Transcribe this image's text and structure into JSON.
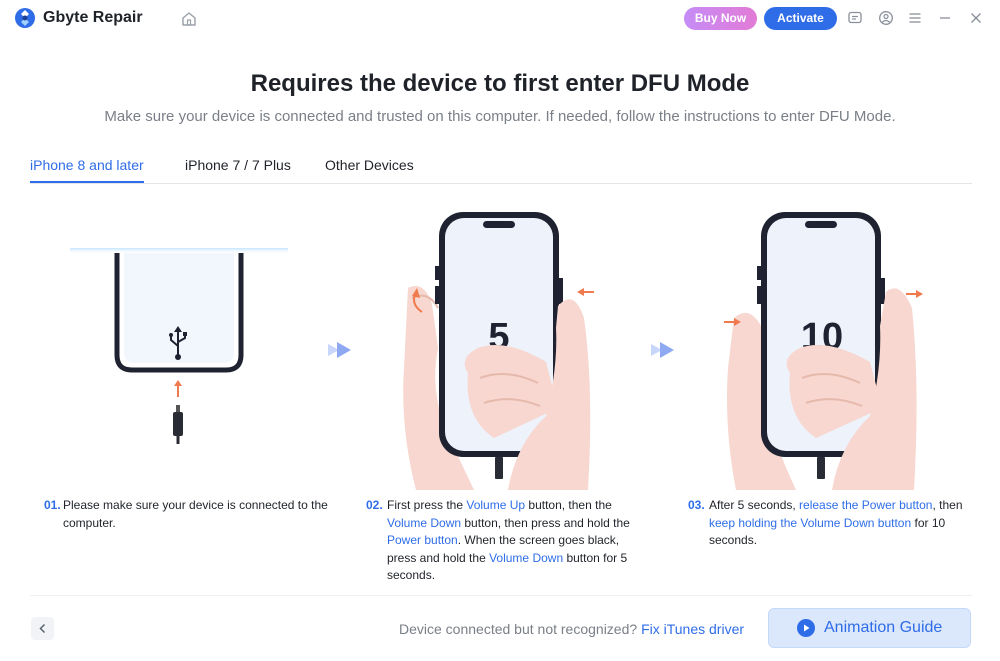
{
  "app": {
    "name": "Gbyte Repair"
  },
  "titlebar": {
    "buy_label": "Buy Now",
    "activate_label": "Activate",
    "icons": [
      "home-icon",
      "feedback-icon",
      "account-icon",
      "menu-icon",
      "minimize-icon",
      "close-icon"
    ]
  },
  "header": {
    "title": "Requires the device to first enter DFU Mode",
    "subtitle": "Make sure your device is connected and trusted on this computer. If needed, follow the instructions to enter DFU Mode."
  },
  "tabs": [
    {
      "label": "iPhone 8 and later",
      "active": true
    },
    {
      "label": "iPhone 7 / 7 Plus",
      "active": false
    },
    {
      "label": "Other Devices",
      "active": false
    }
  ],
  "steps": [
    {
      "num": "01.",
      "parts": [
        "Please make sure your device is connected to the computer."
      ]
    },
    {
      "num": "02.",
      "screen_number": "5",
      "parts": [
        "First press the ",
        "Volume Up",
        " button, then the ",
        "Volume Down",
        " button, then press and hold the ",
        "Power button",
        ". When the screen goes black, press and hold the ",
        "Volume Down",
        " button for 5 seconds."
      ]
    },
    {
      "num": "03.",
      "screen_number": "10",
      "parts": [
        "After 5 seconds, ",
        "release the Power button",
        ", then ",
        "keep holding the Volume Down button",
        " for 10 seconds."
      ]
    }
  ],
  "footer": {
    "help_text": "Device connected but not recognized?",
    "help_link": "Fix iTunes driver",
    "animation_label": "Animation Guide"
  },
  "colors": {
    "accent": "#2f6de8",
    "buy_gradient_start": "#c58cf6",
    "buy_gradient_end": "#e27bd6",
    "arrow": "#f07a4e"
  }
}
